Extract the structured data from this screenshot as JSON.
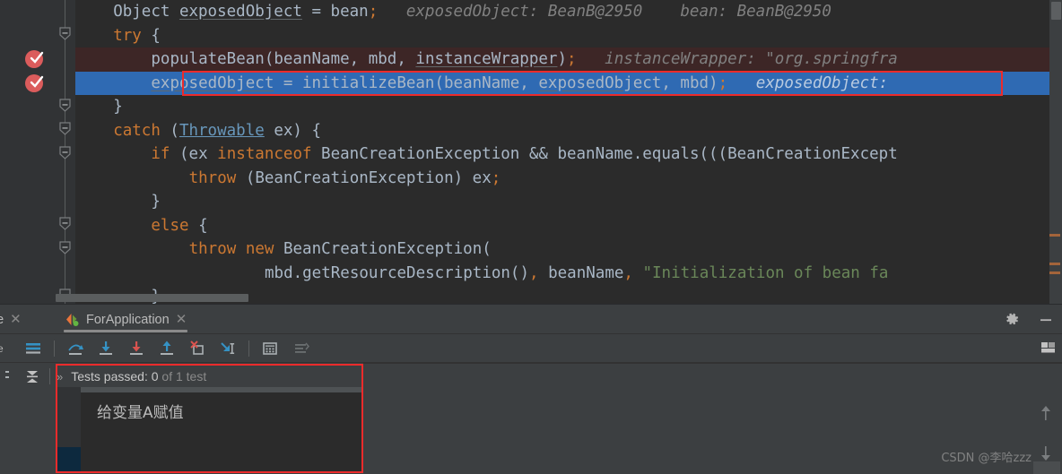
{
  "editor": {
    "code_lines": [
      {
        "indent": 4,
        "tokens": [
          {
            "t": "Object ",
            "c": "plain"
          },
          {
            "t": "exposedObject",
            "c": "ul"
          },
          {
            "t": " = bean",
            "c": "plain"
          },
          {
            "t": ";",
            "c": "sem"
          }
        ],
        "hints": "exposedObject: BeanB@2950    bean: BeanB@2950",
        "state": "normal"
      },
      {
        "indent": 4,
        "tokens": [
          {
            "t": "try",
            "c": "kw"
          },
          {
            "t": " {",
            "c": "plain"
          }
        ],
        "hints": "",
        "state": "normal"
      },
      {
        "indent": 8,
        "tokens": [
          {
            "t": "populateBean(beanName, mbd, ",
            "c": "plain"
          },
          {
            "t": "instanceWrapper",
            "c": "ul"
          },
          {
            "t": ")",
            "c": "plain"
          },
          {
            "t": ";",
            "c": "sem"
          }
        ],
        "hints": "instanceWrapper: \"org.springfra",
        "state": "error"
      },
      {
        "indent": 8,
        "tokens": [
          {
            "t": "exposedObject",
            "c": "ul"
          },
          {
            "t": " = initializeBean(beanName, ",
            "c": "plain"
          },
          {
            "t": "exposedObject",
            "c": "ul"
          },
          {
            "t": ", mbd)",
            "c": "plain"
          },
          {
            "t": ";",
            "c": "sem"
          }
        ],
        "hints": "exposedObject:",
        "state": "exec"
      },
      {
        "indent": 4,
        "tokens": [
          {
            "t": "}",
            "c": "plain"
          }
        ],
        "hints": "",
        "state": "normal"
      },
      {
        "indent": 4,
        "tokens": [
          {
            "t": "catch",
            "c": "kw"
          },
          {
            "t": " (",
            "c": "plain"
          },
          {
            "t": "Throwable",
            "c": "link"
          },
          {
            "t": " ex) {",
            "c": "plain"
          }
        ],
        "hints": "",
        "state": "normal"
      },
      {
        "indent": 8,
        "tokens": [
          {
            "t": "if",
            "c": "kw"
          },
          {
            "t": " (ex ",
            "c": "plain"
          },
          {
            "t": "instanceof",
            "c": "kw"
          },
          {
            "t": " BeanCreationException && beanName.equals(((BeanCreationExcept",
            "c": "plain"
          }
        ],
        "hints": "",
        "state": "normal"
      },
      {
        "indent": 12,
        "tokens": [
          {
            "t": "throw",
            "c": "kw"
          },
          {
            "t": " (BeanCreationException) ex",
            "c": "plain"
          },
          {
            "t": ";",
            "c": "sem"
          }
        ],
        "hints": "",
        "state": "normal"
      },
      {
        "indent": 8,
        "tokens": [
          {
            "t": "}",
            "c": "plain"
          }
        ],
        "hints": "",
        "state": "normal"
      },
      {
        "indent": 8,
        "tokens": [
          {
            "t": "else",
            "c": "kw"
          },
          {
            "t": " {",
            "c": "plain"
          }
        ],
        "hints": "",
        "state": "normal"
      },
      {
        "indent": 12,
        "tokens": [
          {
            "t": "throw",
            "c": "kw"
          },
          {
            "t": " ",
            "c": "plain"
          },
          {
            "t": "new",
            "c": "kw"
          },
          {
            "t": " BeanCreationException(",
            "c": "plain"
          }
        ],
        "hints": "",
        "state": "normal"
      },
      {
        "indent": 20,
        "tokens": [
          {
            "t": "mbd.getResourceDescription()",
            "c": "plain"
          },
          {
            "t": ",",
            "c": "sem"
          },
          {
            "t": " beanName",
            "c": "plain"
          },
          {
            "t": ",",
            "c": "sem"
          },
          {
            "t": " ",
            "c": "plain"
          },
          {
            "t": "\"Initialization of bean fa",
            "c": "str"
          }
        ],
        "hints": "",
        "state": "normal"
      },
      {
        "indent": 8,
        "tokens": [
          {
            "t": "}",
            "c": "plain"
          }
        ],
        "hints": "",
        "state": "normal"
      }
    ],
    "breakpoints": [
      {
        "line_index": 2,
        "label": "breakpoint-verified"
      },
      {
        "line_index": 3,
        "label": "breakpoint-verified"
      }
    ]
  },
  "panel": {
    "tabs": [
      {
        "label": "me",
        "closable": true,
        "active": false,
        "icon": ""
      },
      {
        "label": "ForApplication",
        "closable": true,
        "active": true,
        "icon": "run-config-icon"
      }
    ],
    "header_actions": [
      {
        "name": "settings-gear",
        "glyph": "gear-icon"
      },
      {
        "name": "hide-panel",
        "glyph": "minimize-icon"
      }
    ],
    "toolbar_buttons": [
      {
        "name": "rerun-tests-icon",
        "tooltip": "Rerun"
      },
      {
        "name": "show-execution-point-icon",
        "tooltip": "Show Execution Point"
      },
      {
        "name": "step-over-icon",
        "tooltip": "Step Over"
      },
      {
        "name": "step-into-icon",
        "tooltip": "Step Into"
      },
      {
        "name": "force-step-into-icon",
        "tooltip": "Force Step Into"
      },
      {
        "name": "step-out-icon",
        "tooltip": "Step Out"
      },
      {
        "name": "drop-frame-icon",
        "tooltip": "Drop Frame"
      },
      {
        "name": "run-to-cursor-icon",
        "tooltip": "Run to Cursor"
      },
      {
        "name": "evaluate-expression-icon",
        "tooltip": "Evaluate Expression"
      },
      {
        "name": "trace-icon",
        "tooltip": "Trace Current Stream Chain"
      }
    ],
    "layout_button": {
      "name": "layout-settings-icon"
    },
    "tests": {
      "expand_chevron": "»",
      "status_label": "Tests passed: ",
      "passed_count": "0",
      "of_text": " of 1 test"
    },
    "console": {
      "output": "给变量A赋值"
    },
    "nav": {
      "up": "↑",
      "down": "↓"
    }
  },
  "watermark": "CSDN @李哈zzz",
  "colors": {
    "editor_bg": "#2b2b2b",
    "gutter_bg": "#313335",
    "panel_bg": "#3c3f41",
    "exec_line": "#2f6ab3",
    "error_line": "#3d2626",
    "annotation_red": "#ec2b2b",
    "keyword": "#cc7832",
    "string": "#6a8759",
    "text": "#a9b7c6",
    "breakpoint": "#db5c5c"
  }
}
